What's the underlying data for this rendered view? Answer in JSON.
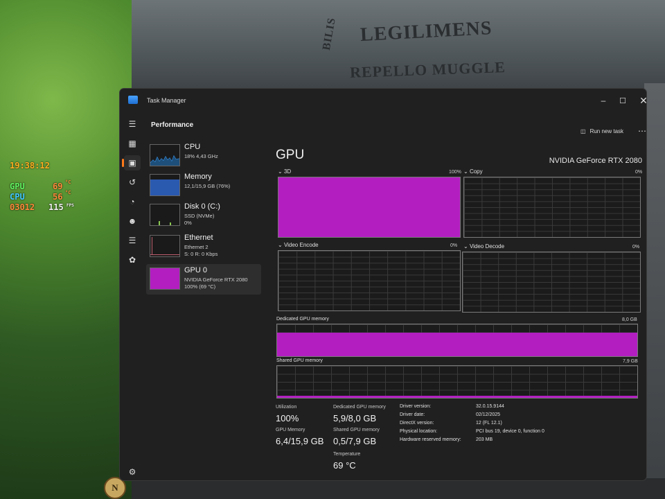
{
  "window": {
    "title": "Task Manager"
  },
  "header": {
    "section": "Performance",
    "run_new_task": "Run new task"
  },
  "sidebar": {
    "items": [
      {
        "name": "CPU",
        "line1": "18% 4,43 GHz",
        "line2": ""
      },
      {
        "name": "Memory",
        "line1": "12,1/15,9 GB (76%)",
        "line2": ""
      },
      {
        "name": "Disk 0 (C:)",
        "line1": "SSD (NVMe)",
        "line2": "0%"
      },
      {
        "name": "Ethernet",
        "line1": "Ethernet 2",
        "line2": "S: 0 R: 0 Kbps"
      },
      {
        "name": "GPU 0",
        "line1": "NVIDIA GeForce RTX 2080",
        "line2": "100% (69 °C)"
      }
    ]
  },
  "gpu": {
    "title": "GPU",
    "model": "NVIDIA GeForce RTX 2080",
    "engines": [
      {
        "label": "3D",
        "value": "100%",
        "usage": 1.0
      },
      {
        "label": "Copy",
        "value": "0%",
        "usage": 0.0
      },
      {
        "label": "Video Encode",
        "value": "0%",
        "usage": 0.0
      },
      {
        "label": "Video Decode",
        "value": "0%",
        "usage": 0.0
      }
    ],
    "dedicated_mem": {
      "label": "Dedicated GPU memory",
      "max": "8,0 GB",
      "usage": 0.74
    },
    "shared_mem": {
      "label": "Shared GPU memory",
      "max": "7,9 GB",
      "usage": 0.06
    },
    "stats": {
      "utilization_label": "Utilization",
      "utilization": "100%",
      "gpu_memory_label": "GPU Memory",
      "gpu_memory": "6,4/15,9 GB",
      "dedicated_label": "Dedicated GPU memory",
      "dedicated": "5,9/8,0 GB",
      "shared_label": "Shared GPU memory",
      "shared": "0,5/7,9 GB",
      "temperature_label": "Temperature",
      "temperature": "69 °C"
    },
    "info": [
      {
        "k": "Driver version:",
        "v": "32.0.15.9144"
      },
      {
        "k": "Driver date:",
        "v": "02/12/2025"
      },
      {
        "k": "DirectX version:",
        "v": "12 (FL 12.1)"
      },
      {
        "k": "Physical location:",
        "v": "PCI bus 19, device 0, function 0"
      },
      {
        "k": "Hardware reserved memory:",
        "v": "203 MB"
      }
    ]
  },
  "overlay": {
    "time": "19:38:12",
    "gpu_label": "GPU",
    "gpu_temp": "69",
    "cpu_label": "CPU",
    "cpu_temp": "56",
    "frame": "03012",
    "fps": "115",
    "fps_label": "FPS",
    "unit": "°C"
  },
  "background": {
    "signs": [
      "LEGILIMENS",
      "REPELLO MUGGLE",
      "BILIS"
    ],
    "badge": "N"
  },
  "colors": {
    "gpu_fill": "#b21ec0",
    "accent": "#ff7a1a"
  }
}
